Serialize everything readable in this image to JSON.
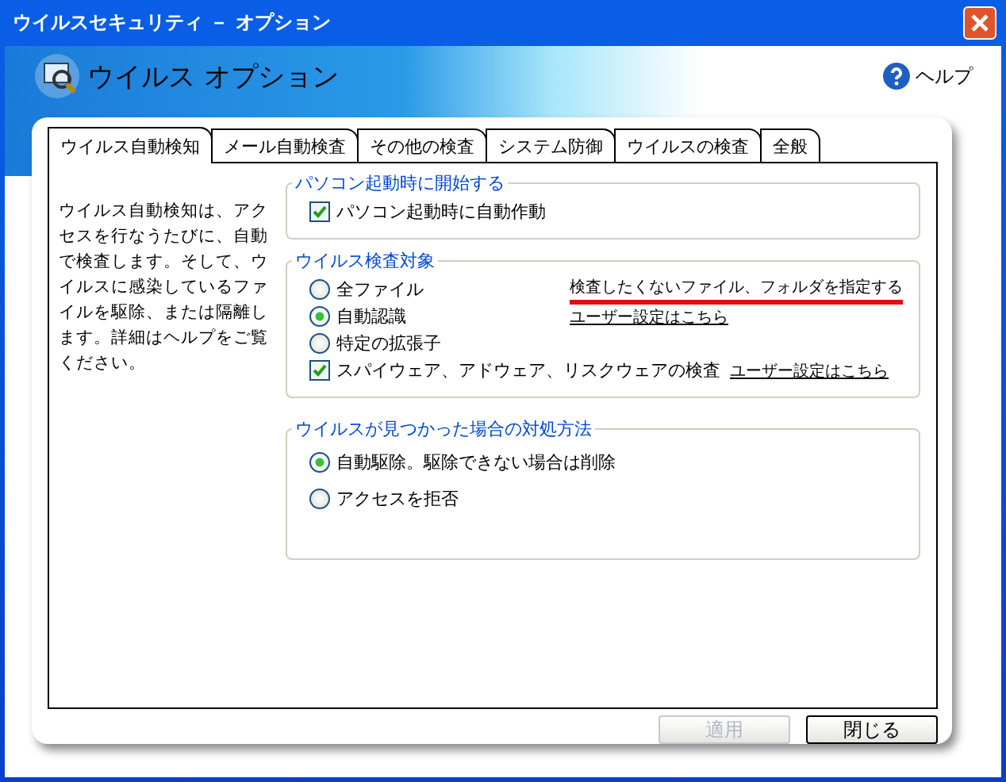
{
  "window": {
    "title": "ウイルスセキュリティ － オプション"
  },
  "header": {
    "title": "ウイルス オプション",
    "help": "ヘルプ"
  },
  "tabs": [
    {
      "label": "ウイルス自動検知",
      "selected": true
    },
    {
      "label": "メール自動検査",
      "selected": false
    },
    {
      "label": "その他の検査",
      "selected": false
    },
    {
      "label": "システム防御",
      "selected": false
    },
    {
      "label": "ウイルスの検査",
      "selected": false
    },
    {
      "label": "全般",
      "selected": false
    }
  ],
  "description": "ウイルス自動検知は、アクセスを行なうたびに、自動で検査します。そして、ウイルスに感染しているファイルを駆除、または隔離します。詳細はヘルプをご覧ください。",
  "groups": [
    {
      "title": "パソコン起動時に開始する",
      "items": [
        {
          "kind": "checkbox",
          "label": "パソコン起動時に自動作動",
          "checked": true
        }
      ]
    },
    {
      "title": "ウイルス検査対象",
      "items": [
        {
          "kind": "radio",
          "label": "全ファイル",
          "selected": false,
          "link": {
            "text": "検査したくないファイル、フォルダを指定する",
            "highlighted": true
          }
        },
        {
          "kind": "radio",
          "label": "自動認識",
          "selected": true,
          "link": {
            "text": "ユーザー設定はこちら",
            "highlighted": false
          }
        },
        {
          "kind": "radio",
          "label": "特定の拡張子",
          "selected": false
        },
        {
          "kind": "checkbox",
          "label": "スパイウェア、アドウェア、リスクウェアの検査",
          "checked": true,
          "link": {
            "text": "ユーザー設定はこちら",
            "highlighted": false
          }
        }
      ]
    },
    {
      "title": "ウイルスが見つかった場合の対処方法",
      "items": [
        {
          "kind": "radio",
          "label": "自動駆除。駆除できない場合は削除",
          "selected": true
        },
        {
          "kind": "radio",
          "label": "アクセスを拒否",
          "selected": false
        }
      ]
    }
  ],
  "buttons": [
    {
      "label": "適用",
      "disabled": true
    },
    {
      "label": "閉じる",
      "disabled": false
    }
  ]
}
